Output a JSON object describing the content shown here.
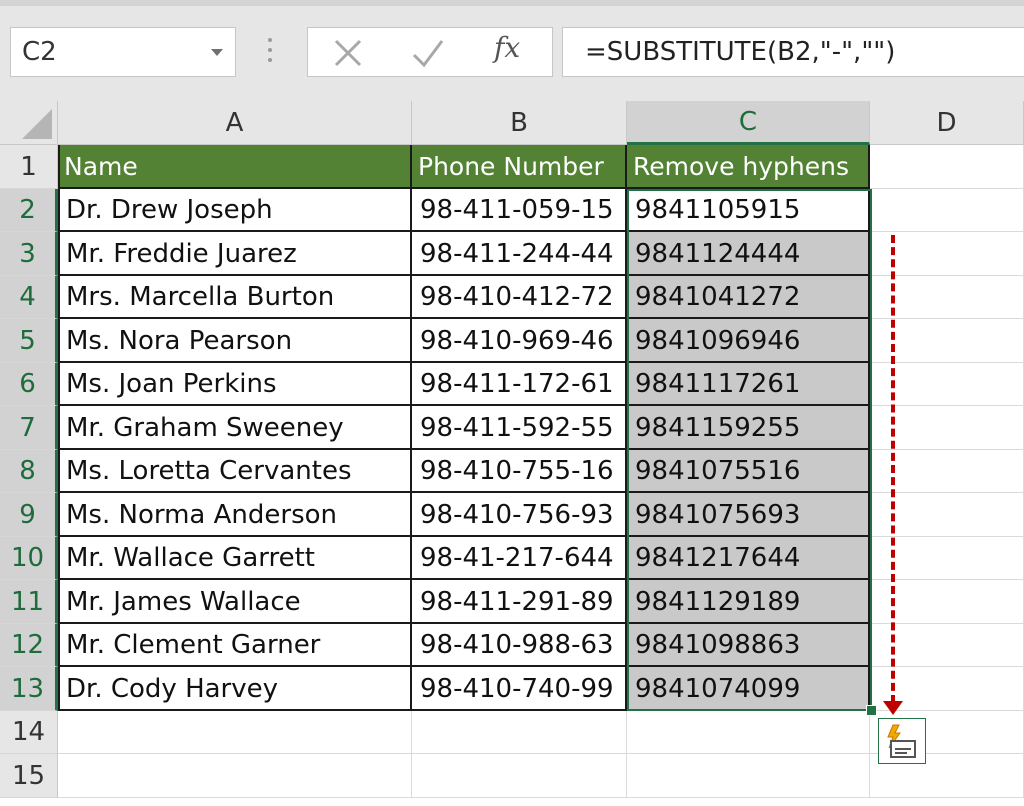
{
  "name_box": {
    "value": "C2"
  },
  "formula_bar": {
    "cancel_icon": "close-icon",
    "enter_icon": "checkmark-icon",
    "fx_label": "fx",
    "formula": "=SUBSTITUTE(B2,\"-\",\"\")"
  },
  "columns": [
    "A",
    "B",
    "C",
    "D"
  ],
  "selected_column": "C",
  "row_numbers": [
    "1",
    "2",
    "3",
    "4",
    "5",
    "6",
    "7",
    "8",
    "9",
    "10",
    "11",
    "12",
    "13",
    "14",
    "15"
  ],
  "table": {
    "headers": [
      "Name",
      "Phone Number",
      "Remove hyphens"
    ],
    "rows": [
      [
        "Dr. Drew Joseph",
        "98-411-059-15",
        "9841105915"
      ],
      [
        "Mr. Freddie Juarez",
        "98-411-244-44",
        "9841124444"
      ],
      [
        "Mrs. Marcella Burton",
        "98-410-412-72",
        "9841041272"
      ],
      [
        "Ms. Nora Pearson",
        "98-410-969-46",
        "9841096946"
      ],
      [
        "Ms. Joan Perkins",
        "98-411-172-61",
        "9841117261"
      ],
      [
        "Mr. Graham Sweeney",
        "98-411-592-55",
        "9841159255"
      ],
      [
        "Ms. Loretta Cervantes",
        "98-410-755-16",
        "9841075516"
      ],
      [
        "Ms. Norma Anderson",
        "98-410-756-93",
        "9841075693"
      ],
      [
        "Mr. Wallace Garrett",
        "98-41-217-644",
        "9841217644"
      ],
      [
        "Mr. James Wallace",
        "98-411-291-89",
        "9841129189"
      ],
      [
        "Mr. Clement Garner",
        "98-410-988-63",
        "9841098863"
      ],
      [
        "Dr. Cody Harvey",
        "98-410-740-99",
        "9841074099"
      ]
    ]
  },
  "colors": {
    "header_fill": "#548235",
    "selection": "#217346",
    "highlight": "#c9c9c9",
    "drag_arrow": "#c00000"
  },
  "quick_analysis_icon": "quick-analysis-icon"
}
